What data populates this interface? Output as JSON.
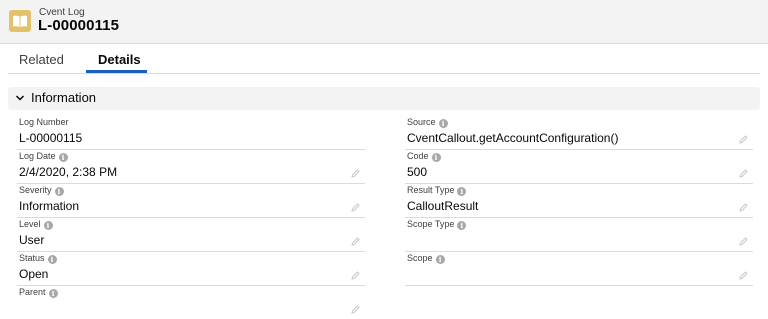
{
  "header": {
    "object_type": "Cvent Log",
    "record_name": "L-00000115",
    "icon": "log-book-icon"
  },
  "tabs": [
    {
      "label": "Related"
    },
    {
      "label": "Details",
      "active": true
    }
  ],
  "section": {
    "title": "Information",
    "icon": "chevron-down-icon"
  },
  "fields": {
    "log_number": {
      "label": "Log Number",
      "value": "L-00000115"
    },
    "log_date": {
      "label": "Log Date",
      "value": "2/4/2020, 2:38 PM"
    },
    "severity": {
      "label": "Severity",
      "value": "Information"
    },
    "level": {
      "label": "Level",
      "value": "User"
    },
    "status": {
      "label": "Status",
      "value": "Open"
    },
    "parent": {
      "label": "Parent",
      "value": ""
    },
    "source": {
      "label": "Source",
      "value": "CventCallout.getAccountConfiguration()"
    },
    "code": {
      "label": "Code",
      "value": "500"
    },
    "result_type": {
      "label": "Result Type",
      "value": "CalloutResult"
    },
    "scope_type": {
      "label": "Scope Type",
      "value": ""
    },
    "scope": {
      "label": "Scope",
      "value": ""
    }
  },
  "colors": {
    "accent": "#1b5fc1",
    "icon_bg": "#e3c26b",
    "header_bg": "#f3f3f3"
  }
}
